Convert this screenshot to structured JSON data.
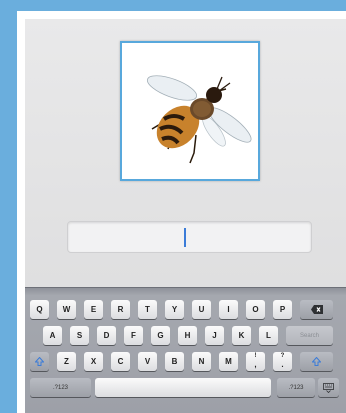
{
  "keyboard": {
    "row1": [
      "Q",
      "W",
      "E",
      "R",
      "T",
      "Y",
      "U",
      "I",
      "O",
      "P"
    ],
    "row2": [
      "A",
      "S",
      "D",
      "F",
      "G",
      "H",
      "J",
      "K",
      "L"
    ],
    "row3": [
      "Z",
      "X",
      "C",
      "V",
      "B",
      "N",
      "M"
    ],
    "punct1": {
      "top": "!",
      "bottom": ","
    },
    "punct2": {
      "top": "?",
      "bottom": "."
    },
    "search_label": "Search",
    "numbers_label": ".?123",
    "icons": {
      "backspace": "backspace-icon",
      "shift": "shift-icon",
      "hide_keyboard": "keyboard-hide-icon"
    }
  },
  "colors": {
    "frame": "#6aaedd",
    "card_border": "#58a8dc",
    "cursor": "#3b7cd8"
  },
  "image": {
    "subject": "bee"
  }
}
